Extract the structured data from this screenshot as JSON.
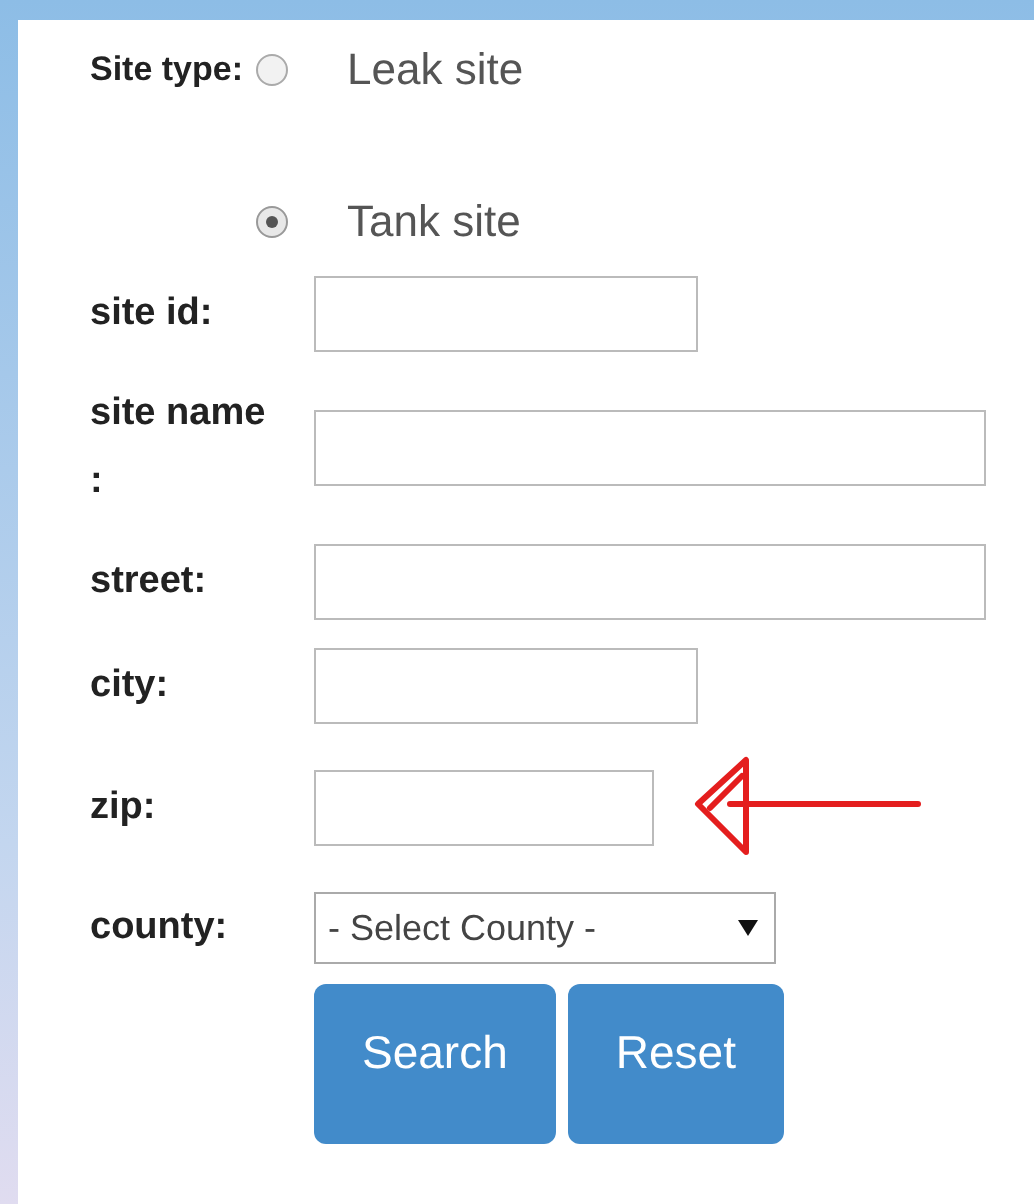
{
  "form": {
    "site_type": {
      "label": "Site type:",
      "options": [
        {
          "label": "Leak site",
          "selected": false
        },
        {
          "label": "Tank site",
          "selected": true
        }
      ]
    },
    "fields": [
      {
        "kind": "text",
        "label": "site id:"
      },
      {
        "kind": "text",
        "label": "site name :"
      },
      {
        "kind": "text",
        "label": "street:"
      },
      {
        "kind": "text",
        "label": "city:"
      },
      {
        "kind": "text",
        "label": "zip:"
      },
      {
        "kind": "select",
        "label": "county:",
        "value": "- Select County -"
      }
    ],
    "buttons": [
      "Search",
      "Reset"
    ]
  }
}
